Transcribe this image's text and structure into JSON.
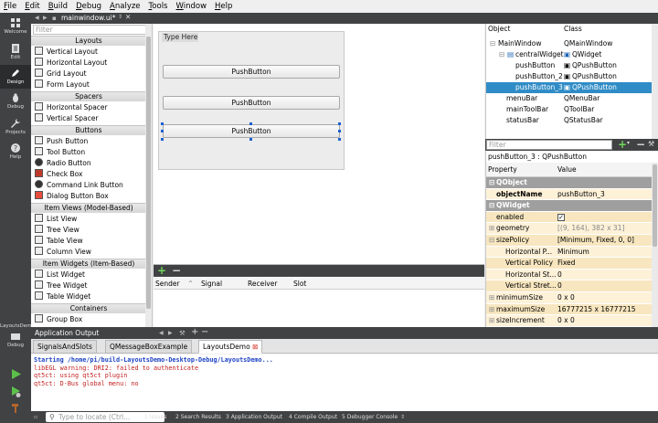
{
  "menubar": [
    "File",
    "Edit",
    "Build",
    "Debug",
    "Analyze",
    "Tools",
    "Window",
    "Help"
  ],
  "modes": [
    {
      "label": "Welcome",
      "icon": "grid-icon"
    },
    {
      "label": "Edit",
      "icon": "document-icon"
    },
    {
      "label": "Design",
      "icon": "pen-icon"
    },
    {
      "label": "Debug",
      "icon": "bug-icon"
    },
    {
      "label": "Projects",
      "icon": "wrench-icon"
    },
    {
      "label": "Help",
      "icon": "question-icon"
    }
  ],
  "kit": {
    "label": "LayoutsDemo",
    "mode": "Debug"
  },
  "editor_tab": "mainwindow.ui*",
  "widgetbox": {
    "filter_placeholder": "Filter",
    "categories": {
      "layouts": "Layouts",
      "spacers": "Spacers",
      "buttons": "Buttons",
      "item_views": "Item Views (Model-Based)",
      "item_widgets": "Item Widgets (Item-Based)",
      "containers": "Containers"
    },
    "items": {
      "vertical_layout": "Vertical Layout",
      "horizontal_layout": "Horizontal Layout",
      "grid_layout": "Grid Layout",
      "form_layout": "Form Layout",
      "horizontal_spacer": "Horizontal Spacer",
      "vertical_spacer": "Vertical Spacer",
      "push_button": "Push Button",
      "tool_button": "Tool Button",
      "radio_button": "Radio Button",
      "check_box": "Check Box",
      "command_link_button": "Command Link Button",
      "dialog_button_box": "Dialog Button Box",
      "list_view": "List View",
      "tree_view": "Tree View",
      "table_view": "Table View",
      "column_view": "Column View",
      "list_widget": "List Widget",
      "tree_widget": "Tree Widget",
      "table_widget": "Table Widget",
      "group_box": "Group Box"
    }
  },
  "form": {
    "type_here": "Type Here",
    "buttons": [
      "PushButton",
      "PushButton",
      "PushButton"
    ]
  },
  "signal_slot": {
    "columns": [
      "Sender",
      "Signal",
      "Receiver",
      "Slot"
    ]
  },
  "object_inspector": {
    "columns": [
      "Object",
      "Class"
    ],
    "rows": [
      {
        "object": "MainWindow",
        "class": "QMainWindow"
      },
      {
        "object": "centralWidget",
        "class": "QWidget"
      },
      {
        "object": "pushButton",
        "class": "QPushButton"
      },
      {
        "object": "pushButton_2",
        "class": "QPushButton"
      },
      {
        "object": "pushButton_3",
        "class": "QPushButton"
      },
      {
        "object": "menuBar",
        "class": "QMenuBar"
      },
      {
        "object": "mainToolBar",
        "class": "QToolBar"
      },
      {
        "object": "statusBar",
        "class": "QStatusBar"
      }
    ]
  },
  "property_editor": {
    "filter_placeholder": "Filter",
    "class_label": "pushButton_3 : QPushButton",
    "columns": [
      "Property",
      "Value"
    ],
    "rows": [
      {
        "property": "QObject",
        "value": ""
      },
      {
        "property": "objectName",
        "value": "pushButton_3"
      },
      {
        "property": "QWidget",
        "value": ""
      },
      {
        "property": "enabled",
        "value": ""
      },
      {
        "property": "geometry",
        "value": "[(9, 164), 382 x 31]"
      },
      {
        "property": "sizePolicy",
        "value": "[Minimum, Fixed, 0, 0]"
      },
      {
        "property": "Horizontal P...",
        "value": "Minimum"
      },
      {
        "property": "Vertical Policy",
        "value": "Fixed"
      },
      {
        "property": "Horizontal St...",
        "value": "0"
      },
      {
        "property": "Vertical Stret...",
        "value": "0"
      },
      {
        "property": "minimumSize",
        "value": "0 x 0"
      },
      {
        "property": "maximumSize",
        "value": "16777215 x 16777215"
      },
      {
        "property": "sizeIncrement",
        "value": "0 x 0"
      }
    ]
  },
  "output": {
    "header": "Application Output",
    "tabs": [
      "SignalsAndSlots",
      "QMessageBoxExample",
      "LayoutsDemo"
    ],
    "lines": [
      "Starting /home/pi/build-LayoutsDemo-Desktop-Debug/LayoutsDemo...",
      "libEGL warning: DRI2: failed to authenticate",
      "qt5ct: using qt5ct plugin",
      "qt5ct: D-Bus global menu: no"
    ]
  },
  "statusbar": {
    "locator_placeholder": "Type to locate (Ctrl...",
    "items": [
      "1 Issues",
      "2 Search Results",
      "3 Application Output",
      "4 Compile Output",
      "5 Debugger Console"
    ]
  }
}
